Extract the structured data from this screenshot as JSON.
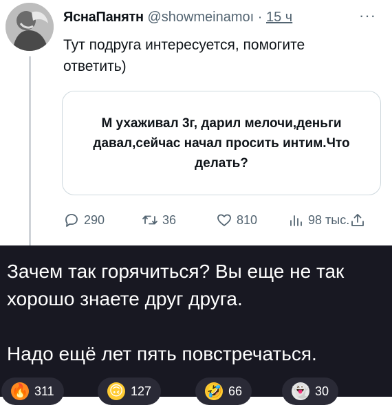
{
  "tweet": {
    "author_name": "ЯснаПанятн",
    "handle": "@showmeinamoı",
    "separator": "·",
    "time": "15 ч",
    "more": "···",
    "text": "Тут подруга интересуется, помогите ответить)",
    "image_text": "М ухаживал 3г, дарил мелочи,деньги давал,сейчас начал просить интим.Что делать?",
    "replies": "290",
    "retweets": "36",
    "likes": "810",
    "views": "98 тыс."
  },
  "comment": {
    "text": "Зачем так горячиться? Вы еще не так хорошо знаете друг друга.\n\nНадо ещё лет пять повстречаться.",
    "reactions": [
      {
        "icon": "fire-icon",
        "count": "311"
      },
      {
        "icon": "upside-down-face-icon",
        "count": "127"
      },
      {
        "icon": "rolling-laughing-face-icon",
        "count": "66"
      },
      {
        "icon": "ghost-icon",
        "count": "30"
      }
    ]
  },
  "colors": {
    "muted": "#536471",
    "text": "#0f1419",
    "border": "#cfd9de",
    "dark_bg": "#181822"
  }
}
